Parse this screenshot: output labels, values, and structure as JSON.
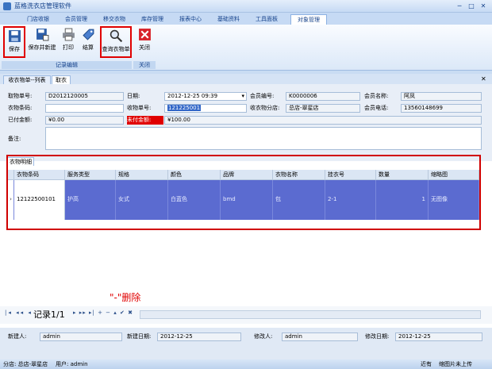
{
  "app": {
    "title": "蓝格洗衣店管理软件"
  },
  "menu": {
    "items": [
      "门店收银",
      "会员管理",
      "移交衣物",
      "库存管理",
      "报表中心",
      "基础资料",
      "工具面板",
      "对象管理"
    ]
  },
  "ribbon": {
    "save": "保存",
    "save_new": "保存并新建",
    "print": "打印",
    "checkout": "结算",
    "query": "查询衣物单",
    "close": "关闭",
    "group_edit": "记录编辑",
    "group_close": "关闭"
  },
  "doctabs": {
    "list": "收衣物单--列表",
    "current": "取衣"
  },
  "form": {
    "take_no_label": "取物单号:",
    "take_no": "D2012120005",
    "date_label": "日期:",
    "date": "2012-12-25 09:39",
    "member_no_label": "会员编号:",
    "member_no": "K0000006",
    "member_name_label": "会员名称:",
    "member_name": "阿凤",
    "barcode_label": "衣物条码:",
    "barcode": "",
    "receipt_no_label": "收物单号:",
    "receipt_no": "121225001",
    "branch_label": "收衣物分店:",
    "branch": "总店-翠星店",
    "phone_label": "会员电话:",
    "phone": "13560148699",
    "paid_label": "已付金额:",
    "paid": "¥0.00",
    "unpaid_label": "未付金额:",
    "unpaid": "¥100.00",
    "remark_label": "备注:"
  },
  "grid": {
    "tab": "衣物明细",
    "columns": [
      "衣物条码",
      "服务类型",
      "规格",
      "颜色",
      "品牌",
      "衣物名称",
      "挂衣号",
      "数量",
      "缩略图"
    ],
    "rows": [
      [
        "12122500101",
        "护高",
        "女式",
        "白蓝色",
        "bmd",
        "包",
        "2-1",
        "1",
        "无图像"
      ]
    ]
  },
  "nav": {
    "record": "记录1/1",
    "delete_hint": "\"-\"删除",
    "buttons": "▸ ▸▸ ▸| + − ▴ ✔ ✖"
  },
  "footer": {
    "creator_label": "新建人:",
    "creator": "admin",
    "create_date_label": "新建日期:",
    "create_date": "2012-12-25",
    "modifier_label": "修改人:",
    "modifier": "admin",
    "modify_date_label": "修改日期:",
    "modify_date": "2012-12-25"
  },
  "status": {
    "branch": "分店: 总店-翠星店",
    "user": "用户: admin",
    "right1": "近有",
    "right2": "缩图片未上传"
  }
}
